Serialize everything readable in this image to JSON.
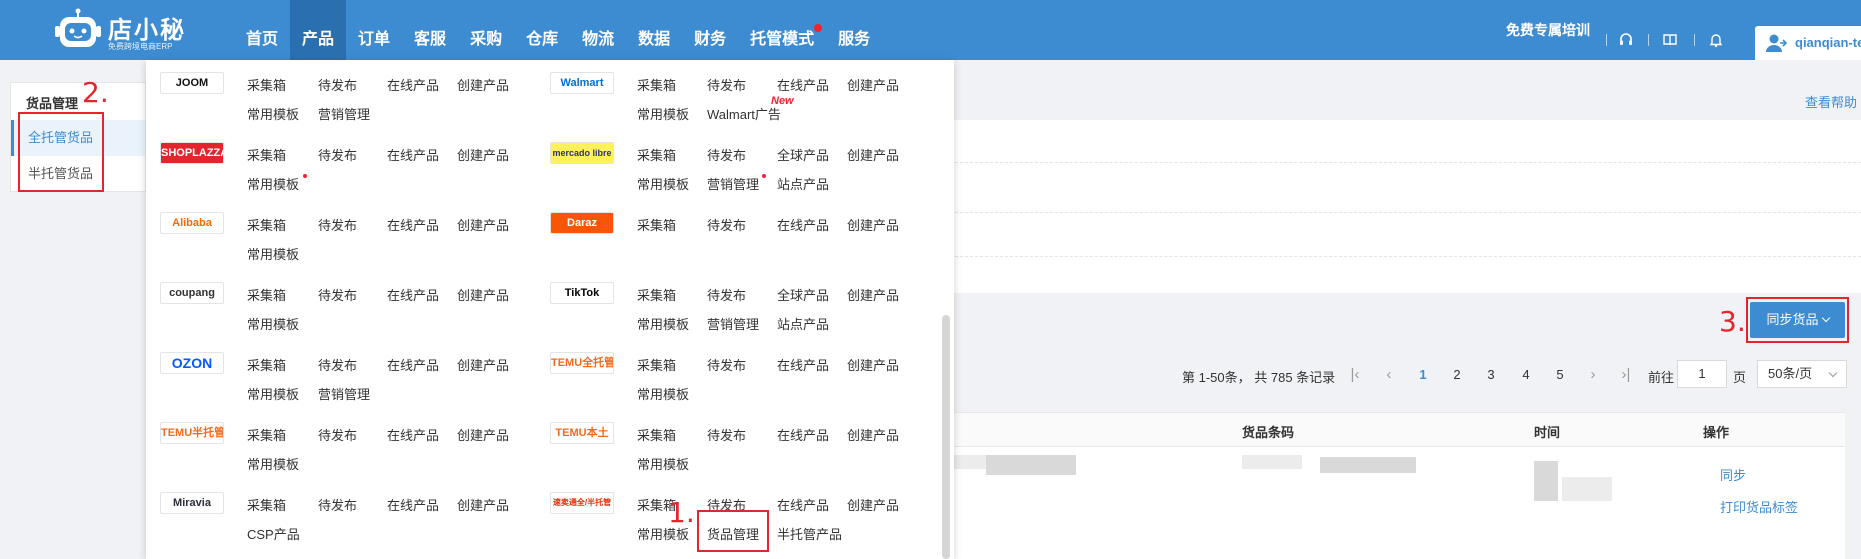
{
  "brand": {
    "name": "店小秘",
    "subtitle": "免费跨境电商ERP"
  },
  "nav": {
    "items": [
      {
        "label": "首页"
      },
      {
        "label": "产品"
      },
      {
        "label": "订单"
      },
      {
        "label": "客服"
      },
      {
        "label": "采购"
      },
      {
        "label": "仓库"
      },
      {
        "label": "物流"
      },
      {
        "label": "数据"
      },
      {
        "label": "财务"
      },
      {
        "label": "托管模式"
      },
      {
        "label": "服务"
      }
    ],
    "active_index": 1
  },
  "header_right": {
    "training": "免费专属培训",
    "username": "qianqian-tes"
  },
  "sidebar": {
    "title": "货品管理",
    "items": [
      {
        "label": "全托管货品"
      },
      {
        "label": "半托管货品"
      }
    ],
    "active_index": 0
  },
  "help_link": "查看帮助",
  "toolbar": {
    "sync_label": "同步货品"
  },
  "pagination": {
    "info": "第 1-50条， 共 785 条记录",
    "pages": [
      "1",
      "2",
      "3",
      "4",
      "5"
    ],
    "current": "1",
    "goto_label": "前往",
    "goto_value": "1",
    "page_label": "页",
    "page_size": "50条/页"
  },
  "table": {
    "headers": {
      "barcode": "货品条码",
      "time": "时间",
      "actions": "操作"
    },
    "row_actions": {
      "sync": "同步",
      "print": "打印货品标签"
    }
  },
  "dropdown": {
    "left": [
      {
        "logo": "JOOM",
        "row1": [
          "采集箱",
          "待发布",
          "在线产品",
          "创建产品"
        ],
        "row2": [
          "常用模板",
          "营销管理"
        ]
      },
      {
        "logo": "SHOPLAZZA",
        "row1": [
          "采集箱",
          "待发布",
          "在线产品",
          "创建产品"
        ],
        "row2": [
          "常用模板"
        ]
      },
      {
        "logo": "Alibaba",
        "row1": [
          "采集箱",
          "待发布",
          "在线产品",
          "创建产品"
        ],
        "row2": [
          "常用模板"
        ]
      },
      {
        "logo": "coupang",
        "row1": [
          "采集箱",
          "待发布",
          "在线产品",
          "创建产品"
        ],
        "row2": [
          "常用模板"
        ]
      },
      {
        "logo": "OZON",
        "row1": [
          "采集箱",
          "待发布",
          "在线产品",
          "创建产品"
        ],
        "row2": [
          "常用模板",
          "营销管理"
        ]
      },
      {
        "logo": "TEMU半托管",
        "row1": [
          "采集箱",
          "待发布",
          "在线产品",
          "创建产品"
        ],
        "row2": [
          "常用模板"
        ]
      },
      {
        "logo": "Miravia",
        "row1": [
          "采集箱",
          "待发布",
          "在线产品",
          "创建产品"
        ],
        "row2": [
          "CSP产品"
        ]
      }
    ],
    "right": [
      {
        "logo": "Walmart",
        "row1": [
          "采集箱",
          "待发布",
          "在线产品",
          "创建产品"
        ],
        "row2": [
          "常用模板",
          "Walmart广告"
        ]
      },
      {
        "logo": "mercado libre",
        "row1": [
          "采集箱",
          "待发布",
          "全球产品",
          "创建产品"
        ],
        "row2": [
          "常用模板",
          "营销管理",
          "站点产品"
        ]
      },
      {
        "logo": "Daraz",
        "row1": [
          "采集箱",
          "待发布",
          "在线产品",
          "创建产品"
        ],
        "row2": []
      },
      {
        "logo": "TikTok",
        "row1": [
          "采集箱",
          "待发布",
          "全球产品",
          "创建产品"
        ],
        "row2": [
          "常用模板",
          "营销管理",
          "站点产品"
        ]
      },
      {
        "logo": "TEMU全托管",
        "row1": [
          "采集箱",
          "待发布",
          "在线产品",
          "创建产品"
        ],
        "row2": [
          "常用模板"
        ]
      },
      {
        "logo": "TEMU本土",
        "row1": [
          "采集箱",
          "待发布",
          "在线产品",
          "创建产品"
        ],
        "row2": [
          "常用模板"
        ]
      },
      {
        "logo": "速卖通全/半托管",
        "row1": [
          "采集箱",
          "待发布",
          "在线产品",
          "创建产品"
        ],
        "row2": [
          "常用模板",
          "货品管理",
          "半托管产品"
        ]
      }
    ],
    "new_badge": "New"
  },
  "annotations": [
    "1.",
    "2.",
    "3."
  ],
  "colors": {
    "primary": "#3d8bd0",
    "header_active": "#2a70b0",
    "annotation": "#e5252b",
    "dot": "#f5222d"
  }
}
